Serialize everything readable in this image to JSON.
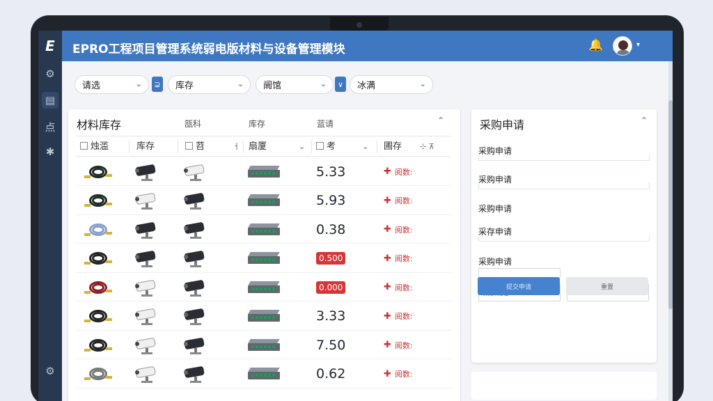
{
  "app": {
    "title": "EPRO工程项目管理系统弱电版材料与设备管理模块",
    "logo_text": "E"
  },
  "sidebar": {
    "items": [
      {
        "icon": "gear-icon",
        "glyph": "⚙"
      },
      {
        "icon": "document-icon",
        "glyph": "▤"
      },
      {
        "icon": "dots-icon",
        "glyph": "点"
      },
      {
        "icon": "puzzle-icon",
        "glyph": "✱"
      }
    ],
    "footer_icon": {
      "icon": "settings-icon",
      "glyph": "⚙"
    }
  },
  "header": {
    "bell_glyph": "🔔",
    "alert_bell_glyph": "🔔",
    "chevron": "▾"
  },
  "filters": [
    {
      "label": "请选",
      "chev": "⌄"
    },
    {
      "label": "库存",
      "chev": "⌄"
    },
    {
      "label": "阛馆",
      "chev": "⌄"
    },
    {
      "label": "冰满",
      "chev": "⌄"
    }
  ],
  "filter_checks": [
    "⊋",
    "∨"
  ],
  "inventory": {
    "title": "材料库存",
    "tabs": [
      "瓿科",
      "库存",
      "蓝请"
    ],
    "collapse": "⌃",
    "columns": [
      "烛滥",
      "库存",
      "苕",
      "扇厦",
      "考",
      "圃存"
    ],
    "rows": [
      {
        "v1": "coil",
        "v2": "cam-dark",
        "v3": "cam-white",
        "v5": "5.33",
        "alert": false,
        "status": "阅数:"
      },
      {
        "v1": "coil",
        "v2": "cam-white",
        "v3": "cam-dark",
        "v5": "5.93",
        "alert": false,
        "status": "阅数:"
      },
      {
        "v1": "coil",
        "v2": "cam-dark",
        "v3": "cam-dark",
        "v5": "0.38",
        "alert": false,
        "status": "阅数:"
      },
      {
        "v1": "coil",
        "v2": "cam-dark",
        "v3": "cam-dark",
        "v5": "0.500",
        "alert": true,
        "status": "阅数:"
      },
      {
        "v1": "coil",
        "v2": "cam-white",
        "v3": "cam-dark",
        "v5": "0.000",
        "alert": true,
        "status": "阅数:"
      },
      {
        "v1": "coil",
        "v2": "cam-white",
        "v3": "cam-dark",
        "v5": "3.33",
        "alert": false,
        "status": "阅数:"
      },
      {
        "v1": "coil",
        "v2": "cam-white",
        "v3": "cam-dark",
        "v5": "7.50",
        "alert": false,
        "status": "阅数:"
      },
      {
        "v1": "coil",
        "v2": "cam-white",
        "v3": "cam-dark",
        "v5": "0.62",
        "alert": false,
        "status": "阅数:"
      }
    ],
    "status_glyph": "✚"
  },
  "purchase": {
    "title": "采购申请",
    "collapse": "⌃",
    "fields": [
      "采购申请",
      "采购申请",
      "采购申请",
      "采存申请",
      "采购申请"
    ],
    "input_placeholder": "案核凝醒",
    "submit_label": "提交申请",
    "reset_label": "重置"
  }
}
